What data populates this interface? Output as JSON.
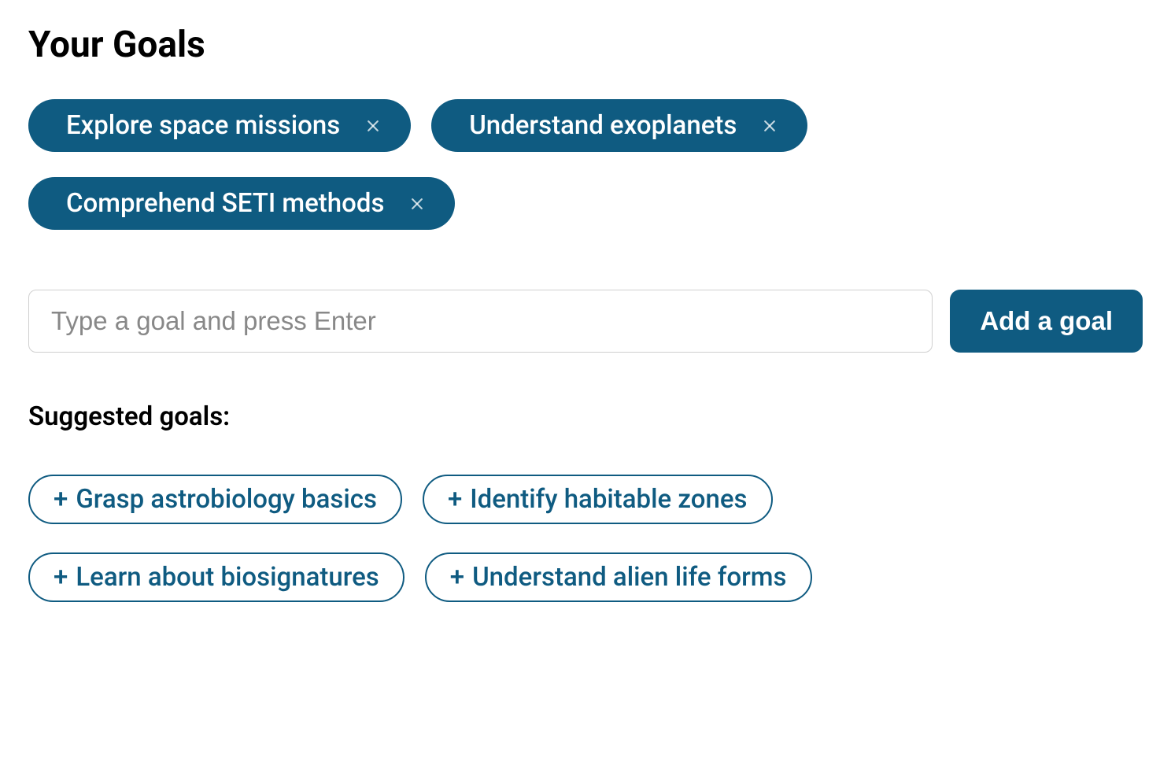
{
  "heading": "Your Goals",
  "goals": [
    {
      "label": "Explore space missions"
    },
    {
      "label": "Understand exoplanets"
    },
    {
      "label": "Comprehend SETI methods"
    }
  ],
  "input": {
    "placeholder": "Type a goal and press Enter",
    "value": ""
  },
  "add_button_label": "Add a goal",
  "suggested_heading": "Suggested goals:",
  "suggested": [
    {
      "label": "Grasp astrobiology basics"
    },
    {
      "label": "Identify habitable zones"
    },
    {
      "label": "Learn about biosignatures"
    },
    {
      "label": "Understand alien life forms"
    }
  ],
  "colors": {
    "primary": "#0f5b81"
  }
}
